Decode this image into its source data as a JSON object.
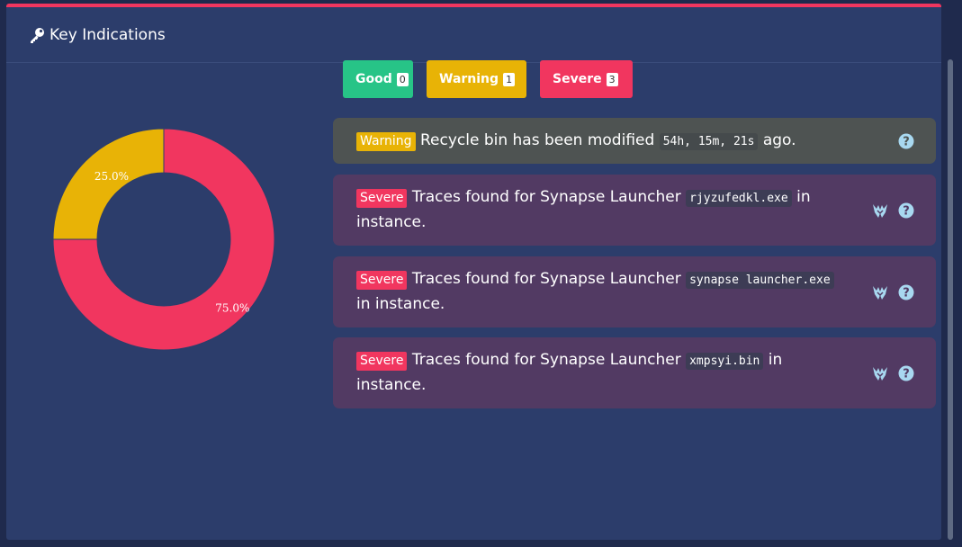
{
  "panel": {
    "title": "Key Indications",
    "accent_color": "#f1365f",
    "header_icon": "key-icon"
  },
  "filters": [
    {
      "label": "Good",
      "count": "0",
      "color": "#27c487"
    },
    {
      "label": "Warning",
      "count": "1",
      "color": "#e8b306"
    },
    {
      "label": "Severe",
      "count": "3",
      "color": "#f1365f"
    }
  ],
  "chart_data": {
    "type": "pie",
    "variant": "donut",
    "slices": [
      {
        "label": "Warning",
        "value": 25.0,
        "display": "25.0%",
        "color": "#e8b306"
      },
      {
        "label": "Severe",
        "value": 75.0,
        "display": "75.0%",
        "color": "#f1365f"
      }
    ]
  },
  "alerts": [
    {
      "level": "Warning",
      "text_before": "Recycle bin has been modified",
      "code": "54h, 15m, 21s",
      "text_after": "ago.",
      "icons": [
        "help-icon"
      ]
    },
    {
      "level": "Severe",
      "text_before": "Traces found for Synapse Launcher",
      "code": "rjyzufedkl.exe",
      "text_after": "in instance.",
      "icons": [
        "synapse-logo-icon",
        "help-icon"
      ]
    },
    {
      "level": "Severe",
      "text_before": "Traces found for Synapse Launcher",
      "code": "synapse launcher.exe",
      "text_after": "in instance.",
      "icons": [
        "synapse-logo-icon",
        "help-icon"
      ]
    },
    {
      "level": "Severe",
      "text_before": "Traces found for Synapse Launcher",
      "code": "xmpsyi.bin",
      "text_after": "in instance.",
      "icons": [
        "synapse-logo-icon",
        "help-icon"
      ]
    }
  ]
}
